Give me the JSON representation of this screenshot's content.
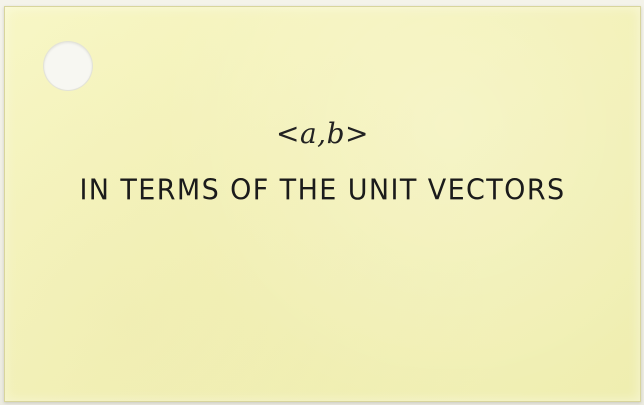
{
  "card": {
    "formula": "<a,b>",
    "caption": "IN TERMS OF THE UNIT VECTORS"
  },
  "colors": {
    "paper": "#F4F2B9",
    "ink": "#1B1B1B",
    "background": "#ECEBE0"
  },
  "icons": {
    "punch_hole": "punch-hole-icon"
  }
}
